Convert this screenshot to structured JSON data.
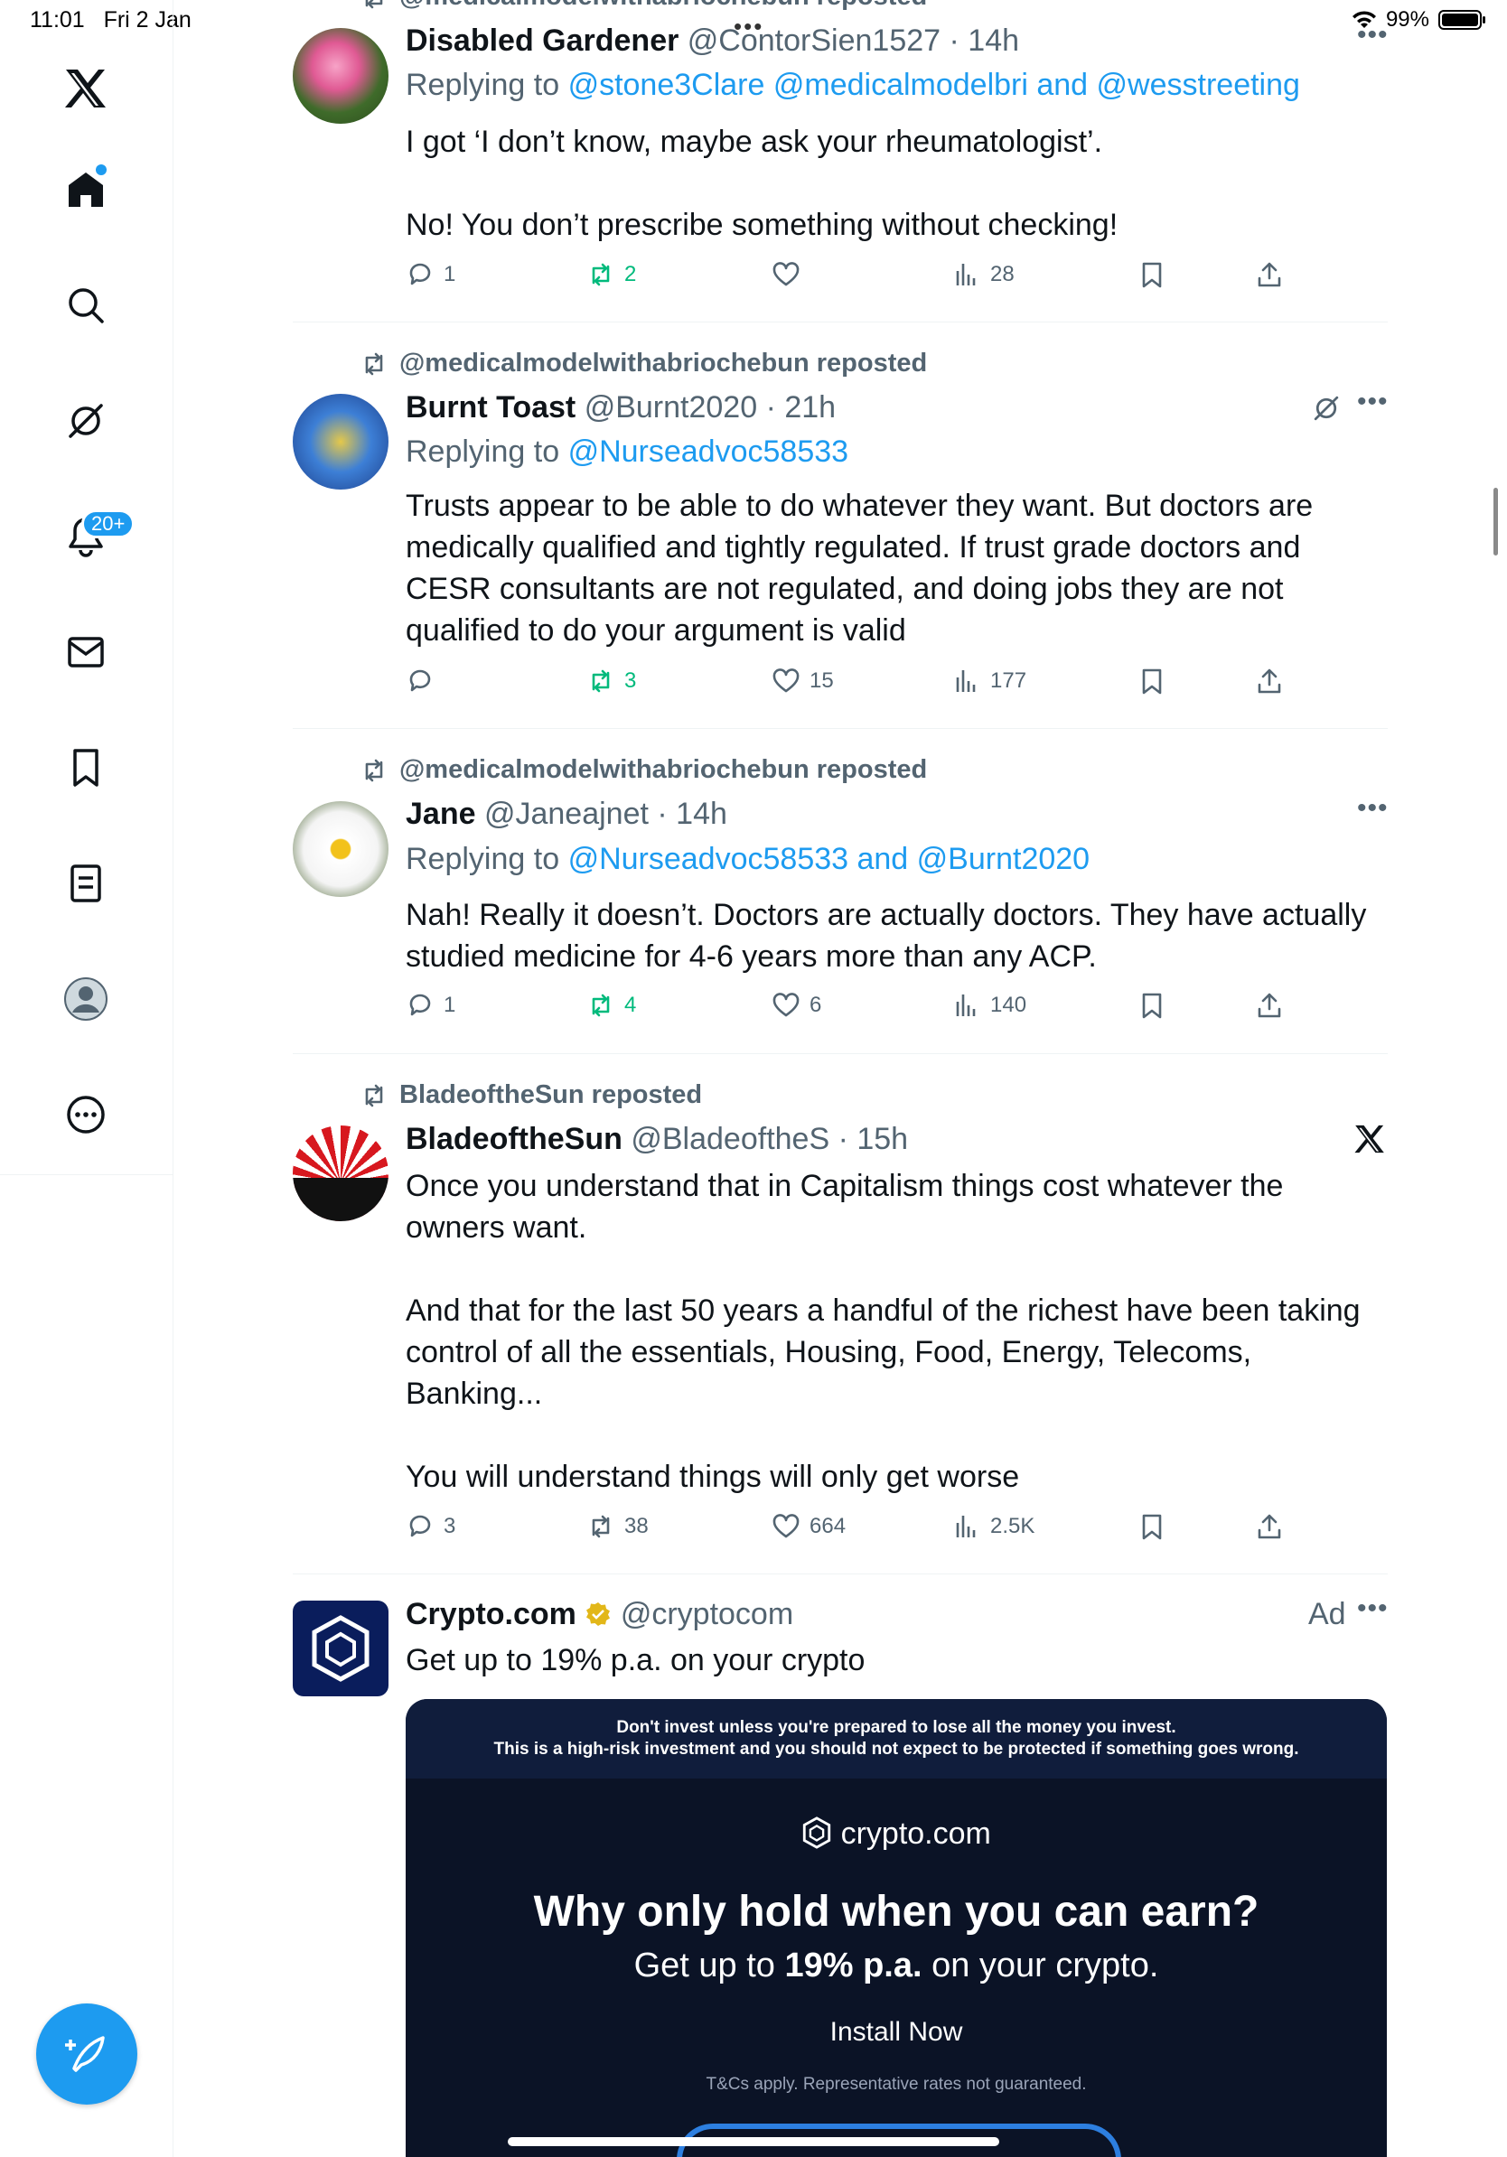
{
  "status_bar": {
    "time": "11:01",
    "date": "Fri 2 Jan",
    "battery": "99%",
    "battery_level": 0.99
  },
  "sidebar": {
    "items": [
      {
        "name": "x-logo",
        "icon": "x-logo-icon"
      },
      {
        "name": "home",
        "icon": "home-icon"
      },
      {
        "name": "search",
        "icon": "search-icon"
      },
      {
        "name": "grok",
        "icon": "grok-icon"
      },
      {
        "name": "notifications",
        "icon": "bell-icon",
        "badge": "20+"
      },
      {
        "name": "messages",
        "icon": "mail-icon"
      },
      {
        "name": "bookmarks",
        "icon": "bookmark-icon"
      },
      {
        "name": "lists",
        "icon": "list-icon"
      },
      {
        "name": "profile",
        "icon": "profile-icon"
      },
      {
        "name": "more",
        "icon": "more-circle-icon"
      }
    ],
    "compose_icon": "compose-feather-icon"
  },
  "posts": [
    {
      "reposted_by": "@medicalmodelwithabriochebun reposted",
      "name": "Disabled Gardener",
      "handle": "@ContorSien1527",
      "time": "14h",
      "replying_label": "Replying to",
      "replying_to": "@stone3Clare @medicalmodelbri and @wesstreeting",
      "text": "I got ‘I don’t know, maybe ask your rheumatologist’.\n\nNo! You don’t prescribe something without checking!",
      "replies": "1",
      "reposts": "2",
      "likes": "",
      "views": "28",
      "more": "•••"
    },
    {
      "reposted_by": "@medicalmodelwithabriochebun reposted",
      "name": "Burnt Toast",
      "handle": "@Burnt2020",
      "time": "21h",
      "replying_label": "Replying to",
      "replying_to": "@Nurseadvoc58533",
      "text": "Trusts appear to be able to do whatever they want. But doctors are medically qualified and tightly regulated. If trust grade doctors and CESR consultants are not regulated, and doing jobs they are not qualified to do your argument is valid",
      "replies": "",
      "reposts": "3",
      "likes": "15",
      "views": "177",
      "more": "•••"
    },
    {
      "reposted_by": "@medicalmodelwithabriochebun reposted",
      "name": "Jane",
      "handle": "@Janeajnet",
      "time": "14h",
      "replying_label": "Replying to",
      "replying_to": "@Nurseadvoc58533 and @Burnt2020",
      "text": "Nah! Really it doesn’t. Doctors are actually doctors. They have actually studied medicine for 4-6 years more than any ACP.",
      "replies": "1",
      "reposts": "4",
      "likes": "6",
      "views": "140",
      "more": "•••"
    },
    {
      "reposted_by": "BladeoftheSun reposted",
      "name": "BladeoftheSun",
      "handle": "@BladeoftheS",
      "time": "15h",
      "text": "Once you understand that in Capitalism things cost whatever the owners want.\n\nAnd that for the last 50 years a handful of the richest have been taking control of all the essentials, Housing, Food, Energy, Telecoms, Banking...\n\nYou will understand things will only get worse",
      "replies": "3",
      "reposts": "38",
      "likes": "664",
      "views": "2.5K"
    }
  ],
  "ad": {
    "name": "Crypto.com",
    "handle": "@cryptocom",
    "label": "Ad",
    "more": "•••",
    "text": "Get up to 19% p.a. on your crypto",
    "warning_line1": "Don't invest unless you're prepared to lose all the money you invest.",
    "warning_line2": "This is a high-risk investment and you should not expect to be protected if something goes wrong.",
    "brand": "crypto.com",
    "headline": "Why only hold when you can earn?",
    "sub_prefix": "Get up to ",
    "sub_bold": "19% p.a.",
    "sub_suffix": " on your crypto.",
    "cta": "Install Now",
    "disclaimer": "T&Cs apply. Representative rates not guaranteed."
  },
  "colors": {
    "accent": "#1d9bf0",
    "repost_green": "#00ba7c",
    "secondary_text": "#536471"
  }
}
